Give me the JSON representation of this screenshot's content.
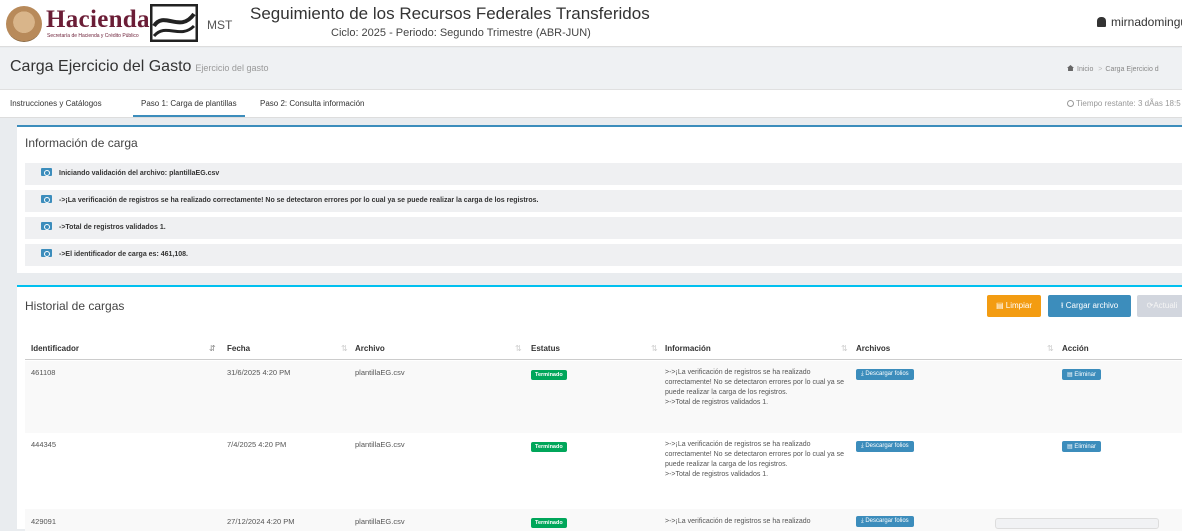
{
  "header": {
    "brand": "Hacienda",
    "brand_sub": "Secretaría de Hacienda y Crédito Público",
    "system_label": "MST",
    "app_title": "Seguimiento de los Recursos Federales Transferidos",
    "cycle": "Ciclo: 2025 - Periodo: Segundo Trimestre (ABR-JUN)",
    "user": "mirnadomingu"
  },
  "page": {
    "title": "Carga Ejercicio del Gasto",
    "subtitle": "Ejercicio del gasto",
    "breadcrumb_home": "Inicio",
    "breadcrumb_sep": ">",
    "breadcrumb_current": "Carga Ejercicio d"
  },
  "tabs": [
    {
      "label": "Instrucciones y Catálogos"
    },
    {
      "label": "Paso 1: Carga de plantillas"
    },
    {
      "label": "Paso 2: Consulta información"
    }
  ],
  "timer": "Tiempo restante: 3 dÃas 18:5",
  "load_info": {
    "title": "Información de carga",
    "messages": [
      "Iniciando validación del archivo: plantillaEG.csv",
      "->¡La verificación de registros se ha realizado correctamente! No se detectaron errores por lo cual ya se puede realizar la carga de los registros.",
      "->Total de registros validados 1.",
      "->El identificador de carga es: 461,108."
    ]
  },
  "history": {
    "title": "Historial de cargas",
    "btn_clear": "Limpiar",
    "btn_upload": "Cargar archivo",
    "btn_refresh": "Actuali",
    "columns": [
      "Identificador",
      "Fecha",
      "Archivo",
      "Estatus",
      "Información",
      "Archivos",
      "Acción"
    ],
    "rows": [
      {
        "id": "461108",
        "date": "31/6/2025 4:20 PM",
        "file": "plantillaEG.csv",
        "status": "Terminado",
        "info": ">->¡La verificación de registros se ha realizado correctamente! No se detectaron errores por lo cual ya se puede realizar la carga de los registros.",
        "info2": ">->Total de registros validados 1.",
        "download": "Descargar folios",
        "action": "Eliminar"
      },
      {
        "id": "444345",
        "date": "7/4/2025 4:20 PM",
        "file": "plantillaEG.csv",
        "status": "Terminado",
        "info": ">->¡La verificación de registros se ha realizado correctamente! No se detectaron errores por lo cual ya se puede realizar la carga de los registros.",
        "info2": ">->Total de registros validados 1.",
        "download": "Descargar folios",
        "action": "Eliminar"
      },
      {
        "id": "429091",
        "date": "27/12/2024 4:20 PM",
        "file": "plantillaEG.csv",
        "status": "Terminado",
        "info": ">->¡La verificación de registros se ha realizado",
        "download": "Descargar folios"
      }
    ]
  },
  "colors": {
    "primary": "#3c8dbc",
    "success": "#00a65a",
    "warning": "#f39c12",
    "brand": "#6b1d36",
    "info_border": "#00c0ef"
  }
}
